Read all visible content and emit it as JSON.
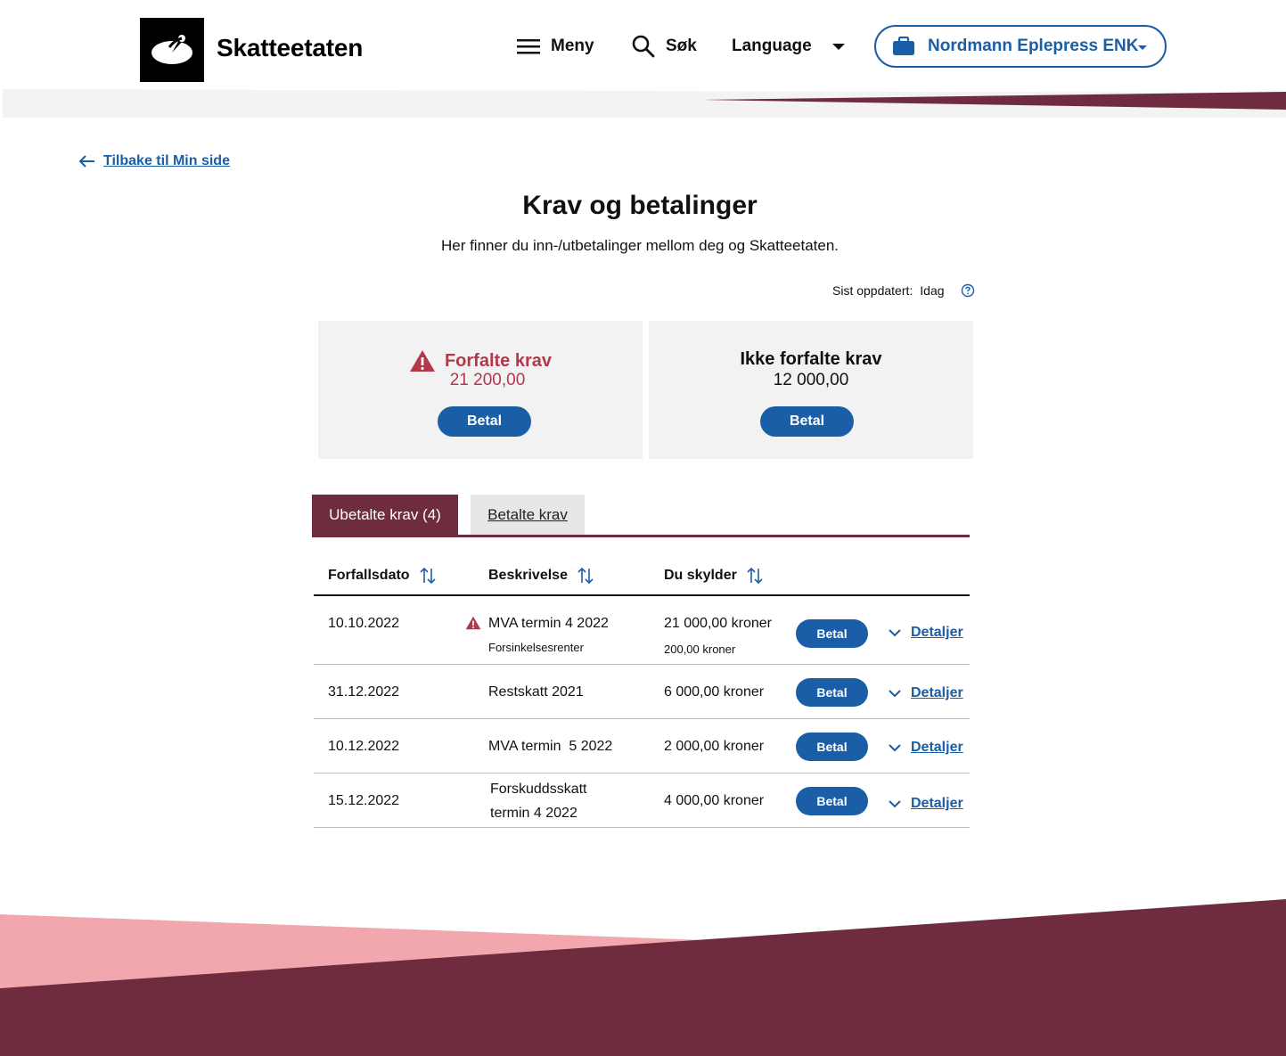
{
  "header": {
    "logo_text": "Skatteetaten",
    "menu_label": "Meny",
    "search_label": "Søk",
    "language_label": "Language",
    "org_label": "Nordmann Eplepress ENK"
  },
  "back_link": "Tilbake til Min side",
  "page": {
    "title": "Krav og betalinger",
    "intro": "Her finner du inn-/utbetalinger mellom deg og Skatteetaten.",
    "updated_label": "Sist oppdatert:",
    "updated_value": "Idag"
  },
  "summary": {
    "overdue_title": "Forfalte krav",
    "overdue_amount": "21 200,00",
    "overdue_button": "Betal",
    "not_due_title": "Ikke forfalte krav",
    "not_due_amount": "12 000,00",
    "not_due_button": "Betal"
  },
  "tabs": {
    "unpaid": "Ubetalte krav (4)",
    "paid": "Betalte krav"
  },
  "table": {
    "headers": {
      "due_date": "Forfallsdato",
      "description": "Beskrivelse",
      "amount": "Du skylder"
    },
    "rows": [
      {
        "date": "10.10.2022",
        "description": "MVA termin 4 2022",
        "sub_description": "Forsinkelsesrenter",
        "amount": "21 000,00 kroner",
        "sub_amount": "200,00 kroner",
        "button": "Betal",
        "details": "Detaljer"
      },
      {
        "date": "31.12.2022",
        "description": "Restskatt 2021",
        "amount": "6 000,00 kroner",
        "button": "Betal",
        "details": "Detaljer"
      },
      {
        "date": "10.12.2022",
        "description": "MVA termin  5 2022",
        "amount": "2 000,00 kroner",
        "button": "Betal",
        "details": "Detaljer"
      },
      {
        "date": "15.12.2022",
        "description_line1": "Forskuddsskatt",
        "description_line2": "termin 4 2022",
        "amount": "4 000,00 kroner",
        "button": "Betal",
        "details": "Detaljer"
      }
    ]
  },
  "colors": {
    "primary_blue": "#1a5ea8",
    "brand_wine": "#6f2c3f",
    "alert_red": "#b2394b",
    "pink": "#f2a7ae",
    "card_bg": "#f2f2f2"
  },
  "icons": [
    "logo-icon",
    "hamburger-icon",
    "search-icon",
    "caret-down-icon",
    "briefcase-icon",
    "arrow-left-icon",
    "help-icon",
    "warning-icon",
    "sort-icon",
    "chevron-down-icon"
  ]
}
